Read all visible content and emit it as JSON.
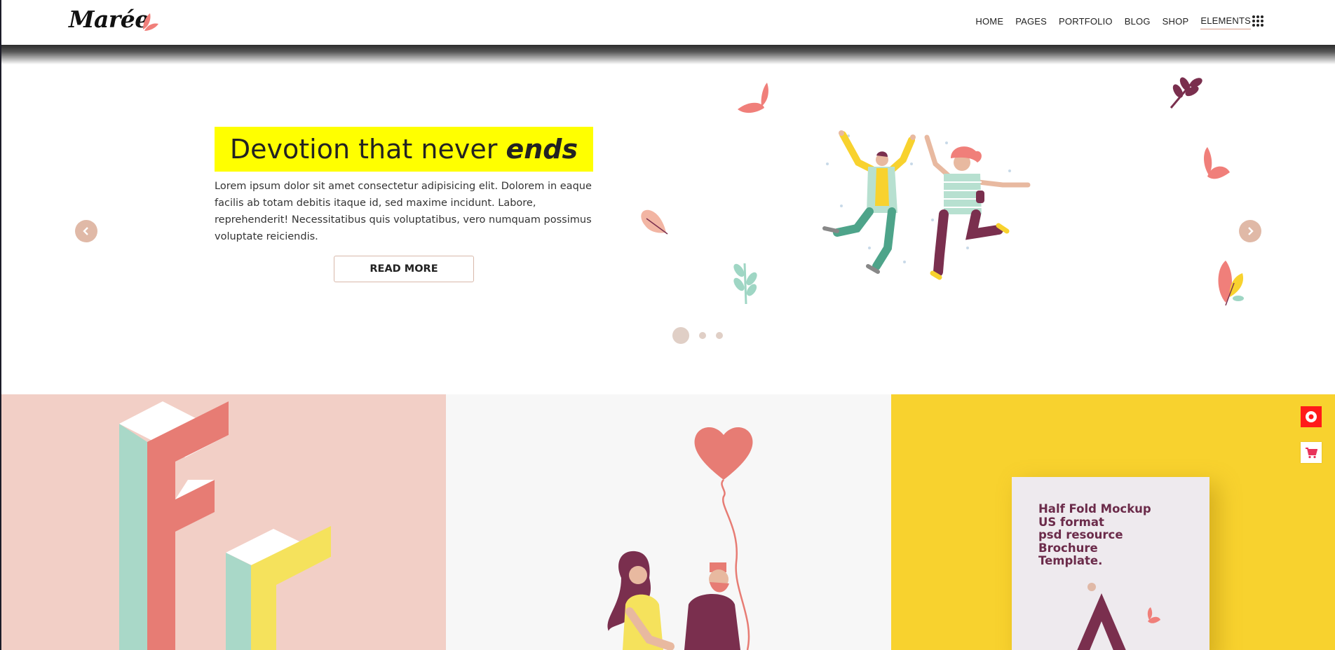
{
  "brand": {
    "logo_text": "Marée",
    "accent": "#f07f7a"
  },
  "nav": {
    "items": [
      {
        "label": "HOME"
      },
      {
        "label": "PAGES"
      },
      {
        "label": "PORTFOLIO"
      },
      {
        "label": "BLOG"
      },
      {
        "label": "SHOP"
      },
      {
        "label": "ELEMENTS"
      }
    ],
    "active": "ELEMENTS",
    "menu_icon": "grid-dots-icon"
  },
  "hero": {
    "headline_main": "Devotion that never",
    "headline_emph": "ends",
    "highlight_color": "#ffff00",
    "description": "Lorem ipsum dolor sit amet consectetur adipisicing elit. Dolorem in eaque facilis ab totam debitis itaque id, sed maxime incidunt. Labore, reprehenderit! Necessitatibus quis voluptatibus, vero numquam possimus voluptate reiciendis.",
    "cta_label": "READ MORE",
    "prev_icon": "chevron-left-icon",
    "next_icon": "chevron-right-icon",
    "slides_total": 3,
    "active_slide": 1
  },
  "panels": [
    {
      "name": "letter-f-isometric",
      "background": "#f2cfc6"
    },
    {
      "name": "couple-heart-balloon",
      "background": "#f7f7f7"
    },
    {
      "name": "brochure-mockup",
      "background": "#f8d22e",
      "brochure_lines": [
        "Half Fold Mockup",
        "US format",
        "psd resource",
        "Brochure",
        "Template."
      ]
    }
  ],
  "side_buttons": [
    {
      "icon": "record-icon",
      "color": "#ff1a1a"
    },
    {
      "icon": "cart-icon",
      "color": "#e8335a"
    }
  ]
}
